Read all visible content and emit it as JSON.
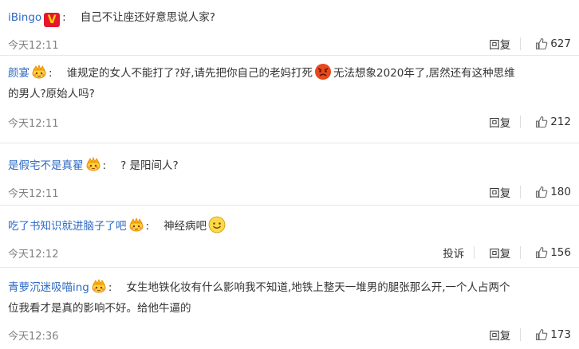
{
  "comments": [
    {
      "user": "iBingo",
      "text": "自己不让座还好意思说人家?",
      "time": "今天12:11",
      "reply_label": "回复",
      "likes": "627"
    },
    {
      "user": "颜宴",
      "text_a": "谁规定的女人不能打了?好,请先把你自己的老妈打死",
      "text_b": "无法想象2020年了,居然还有这种思维",
      "text_c": "的男人?原始人吗?",
      "time": "今天12:11",
      "reply_label": "回复",
      "likes": "212"
    },
    {
      "user": "是假宅不是真翟",
      "text": "? 是阳间人?",
      "time": "今天12:11",
      "reply_label": "回复",
      "likes": "180"
    },
    {
      "user": "吃了书知识就进脑子了吧",
      "text": "神经病吧",
      "time": "今天12:12",
      "report_label": "投诉",
      "reply_label": "回复",
      "likes": "156"
    },
    {
      "user": "青萝沉迷吸喵ing",
      "text_a": "女生地铁化妆有什么影响我不知道,地铁上整天一堆男的腿张那么开,一个人占两个",
      "text_b": "位我看才是真的影响不好。给他牛逼的",
      "time": "今天12:36",
      "reply_label": "回复",
      "likes": "173"
    }
  ],
  "badge_v": "V",
  "colors": {
    "username": "#2d6ac4",
    "text": "#333333",
    "time": "#808080",
    "badge": "#e6162d"
  }
}
